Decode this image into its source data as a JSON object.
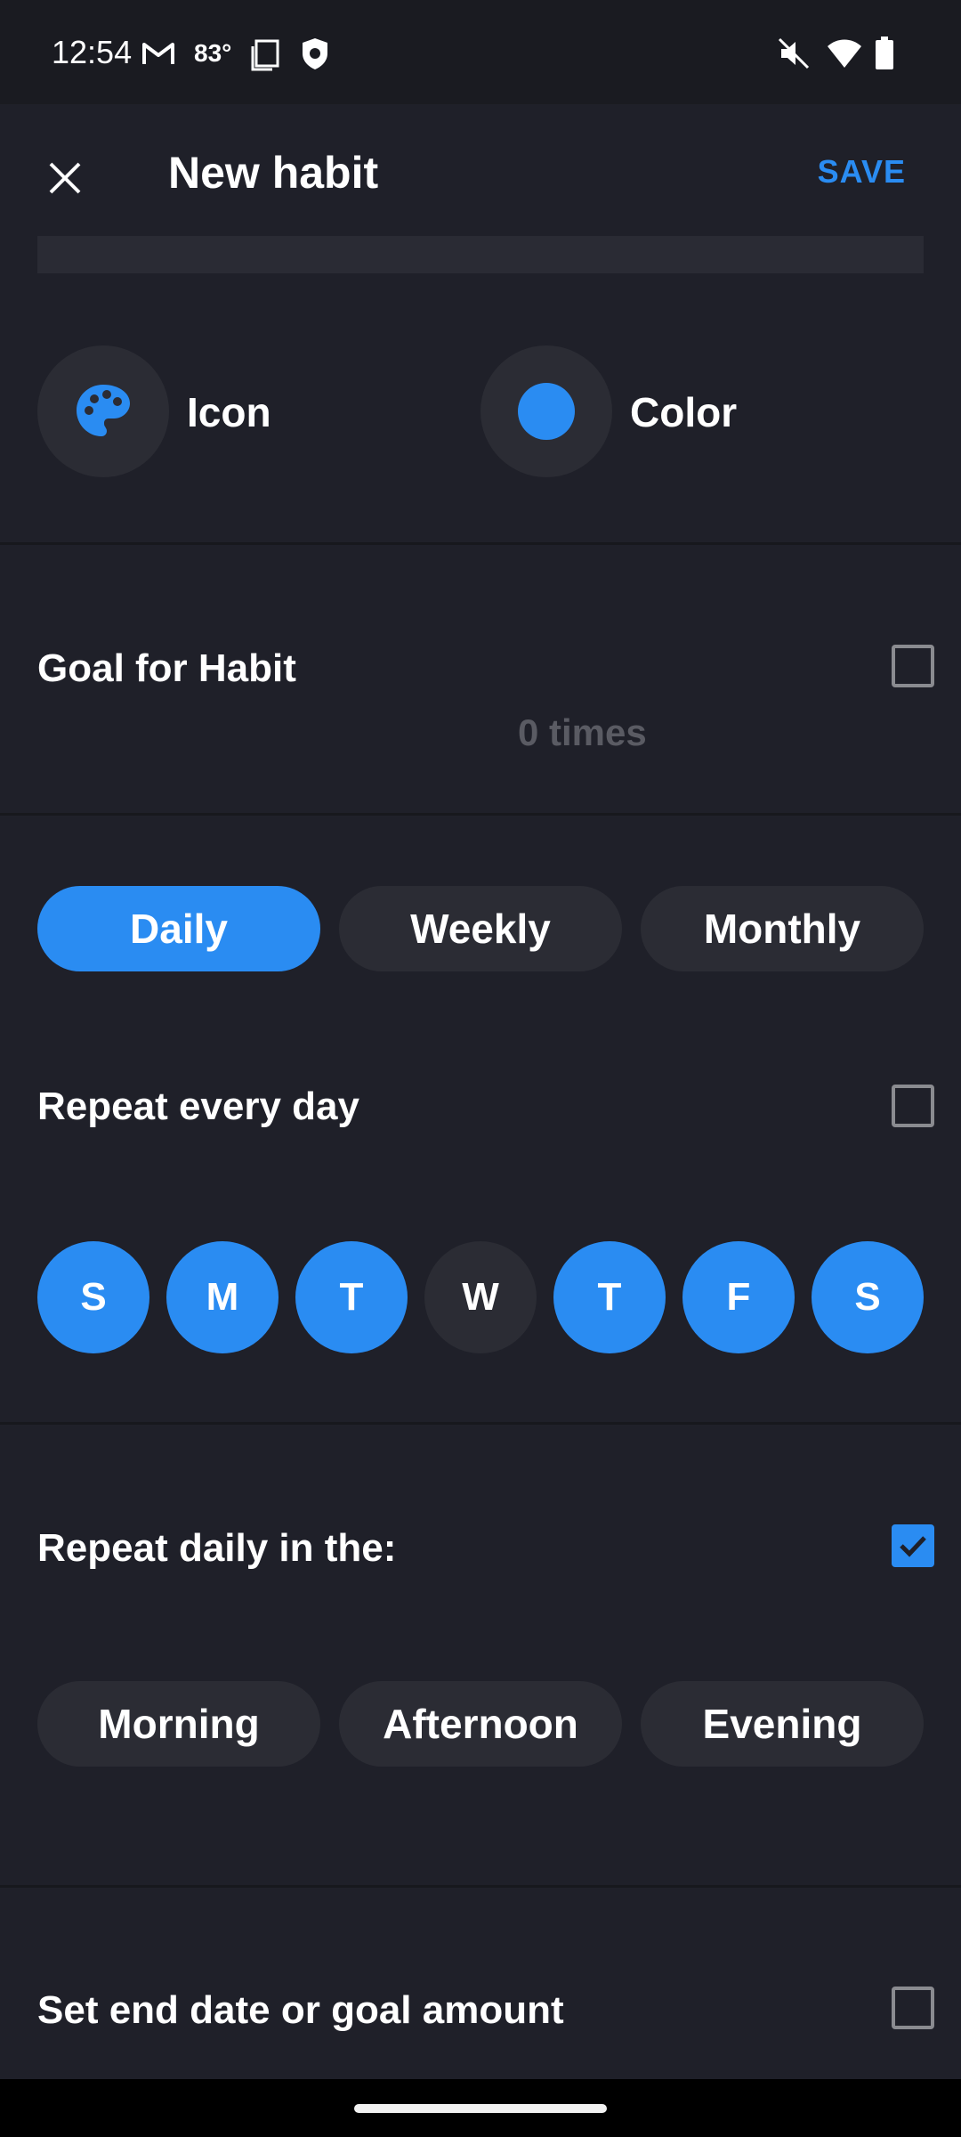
{
  "status_bar": {
    "time": "12:54",
    "temperature": "83°",
    "icons": [
      "gmail-icon",
      "screenshot-icon",
      "shield-icon",
      "mute-icon",
      "wifi-icon",
      "battery-icon"
    ]
  },
  "app_bar": {
    "title": "New habit",
    "save_label": "SAVE",
    "close_icon": "close-icon"
  },
  "appearance": {
    "icon_label": "Icon",
    "color_label": "Color",
    "accent_color": "#2a8cf2"
  },
  "goal": {
    "label": "Goal for Habit",
    "value": "0 times",
    "checked": false
  },
  "frequency": {
    "options": [
      "Daily",
      "Weekly",
      "Monthly"
    ],
    "selected": "Daily"
  },
  "repeat_every_day": {
    "label": "Repeat every day",
    "checked": false
  },
  "days": [
    {
      "letter": "S",
      "selected": true
    },
    {
      "letter": "M",
      "selected": true
    },
    {
      "letter": "T",
      "selected": true
    },
    {
      "letter": "W",
      "selected": false
    },
    {
      "letter": "T",
      "selected": true
    },
    {
      "letter": "F",
      "selected": true
    },
    {
      "letter": "S",
      "selected": true
    }
  ],
  "time_of_day": {
    "label": "Repeat daily in the:",
    "checked": true,
    "options": [
      "Morning",
      "Afternoon",
      "Evening"
    ]
  },
  "end_date": {
    "label": "Set end date or goal amount",
    "checked": false
  }
}
